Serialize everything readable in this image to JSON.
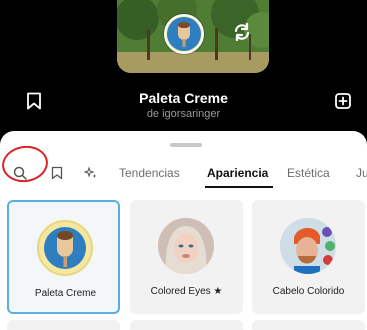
{
  "effect": {
    "name": "Paleta Creme",
    "author": "de igorsaringer"
  },
  "tabs": [
    {
      "label": "Tendencias",
      "active": false
    },
    {
      "label": "Apariencia",
      "active": true
    },
    {
      "label": "Estética",
      "active": false
    },
    {
      "label": "Ju",
      "active": false
    }
  ],
  "effects_grid": [
    {
      "label": "Paleta Creme",
      "selected": true
    },
    {
      "label": "Colored Eyes ★",
      "selected": false
    },
    {
      "label": "Cabelo Colorido",
      "selected": false
    }
  ],
  "icons": {
    "flip": "flip-camera-icon",
    "save": "bookmark-icon",
    "add": "add-effect-icon",
    "search": "search-icon",
    "saved_tab": "bookmark-icon",
    "sparkle_tab": "sparkle-icon"
  },
  "colors": {
    "selected_border": "#5aaee0",
    "annotation_circle": "#d6262b",
    "active_tab": "#111111"
  }
}
